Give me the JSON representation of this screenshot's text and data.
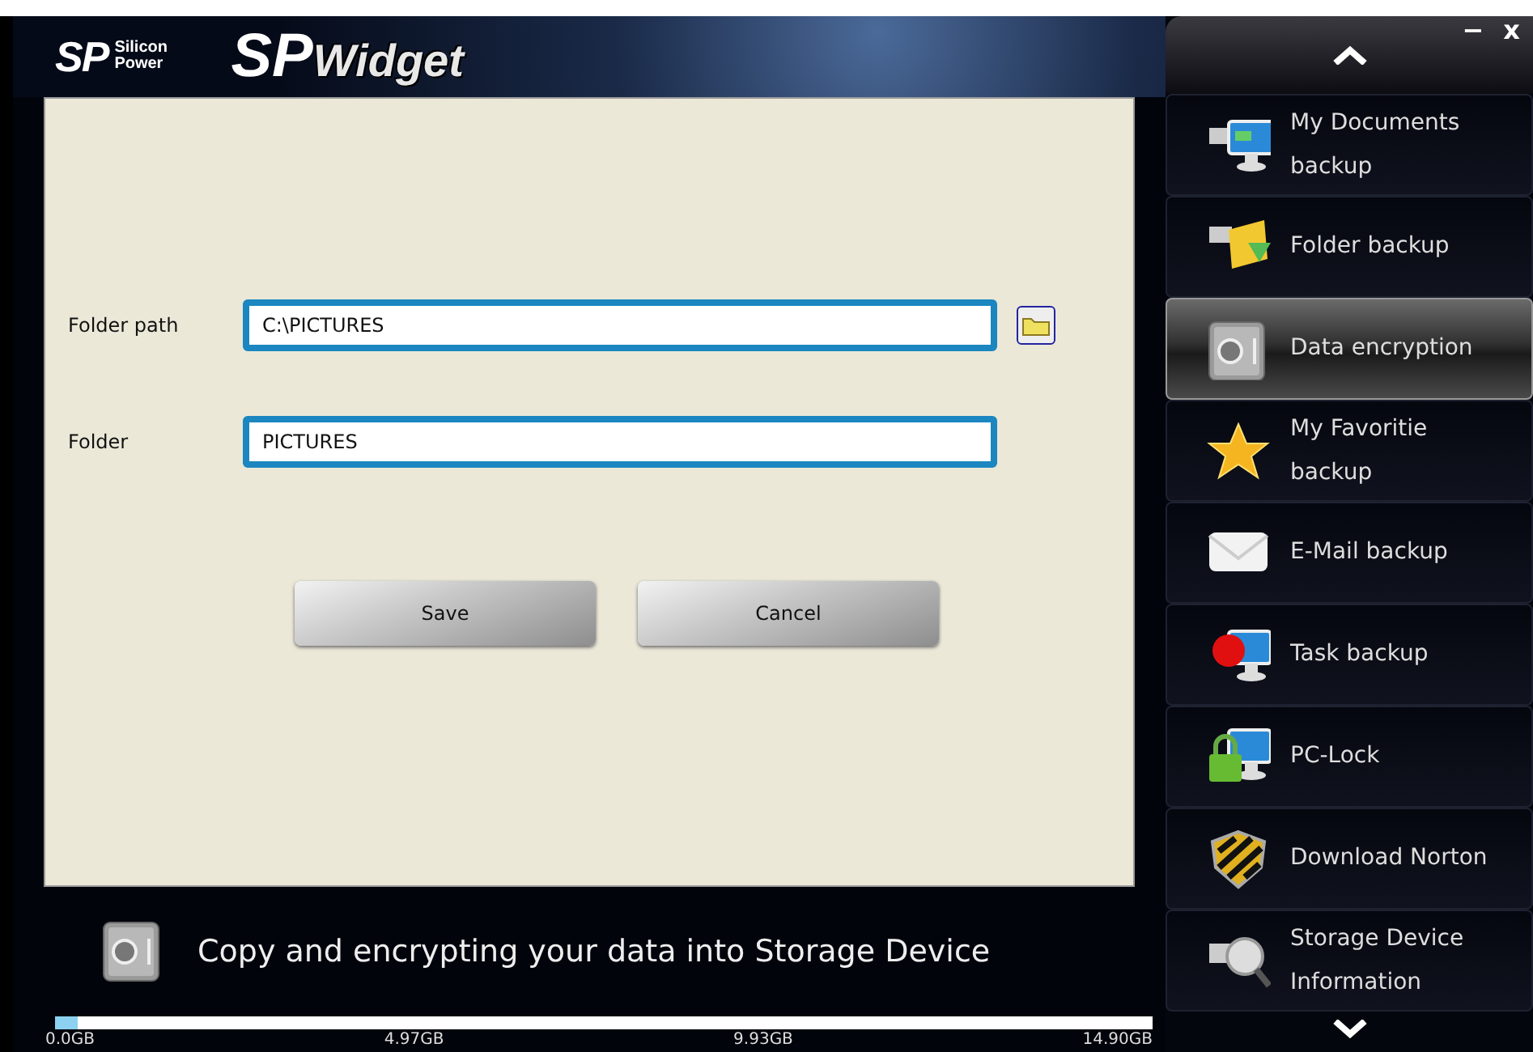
{
  "header": {
    "brand": {
      "mark": "SP",
      "name": "Silicon Power"
    },
    "product_logo": {
      "mark": "SP",
      "name": "Widget"
    }
  },
  "window_controls": [
    "−",
    "x"
  ],
  "form": {
    "fields": [
      {
        "label": "Folder path",
        "value": "C:\\PICTURES",
        "browse": true
      },
      {
        "label": "Folder",
        "value": "PICTURES",
        "browse": false
      }
    ],
    "buttons": [
      "Save",
      "Cancel"
    ]
  },
  "footer": {
    "description": "Copy and encrypting your data into Storage Device"
  },
  "storage": {
    "level": 0.02,
    "ticks": [
      "0.0GB",
      "4.97GB",
      "9.93GB",
      "14.90GB"
    ]
  },
  "sidebar": {
    "items": [
      {
        "label": "My Documents backup",
        "selected": false
      },
      {
        "label": "Folder backup",
        "selected": false
      },
      {
        "label": "Data encryption",
        "selected": true
      },
      {
        "label": "My Favoritie backup",
        "selected": false
      },
      {
        "label": "E-Mail backup",
        "selected": false
      },
      {
        "label": "Task backup",
        "selected": false
      },
      {
        "label": "PC-Lock",
        "selected": false
      },
      {
        "label": "Download Norton",
        "selected": false
      },
      {
        "label": "Storage Device Information",
        "selected": false
      }
    ]
  }
}
